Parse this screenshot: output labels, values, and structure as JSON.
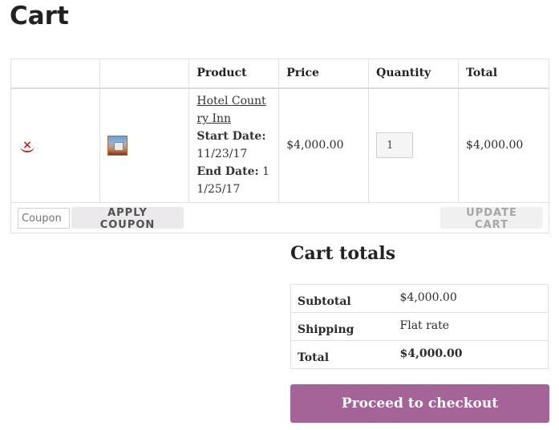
{
  "page": {
    "title": "Cart"
  },
  "cart_table": {
    "headers": [
      "",
      "",
      "Product",
      "Price",
      "Quantity",
      "Total"
    ],
    "item": {
      "remove_symbol": "×",
      "product_name": "Hotel Country Inn",
      "start_label": "Start Date:",
      "start_value": "11/23/17",
      "end_label": "End Date:",
      "end_value": "11/25/17",
      "price": "$4,000.00",
      "quantity": "1",
      "total": "$4,000.00",
      "thumbnail_icon": "hotel-image-icon"
    },
    "coupon_placeholder": "Coupon",
    "apply_coupon_label": "APPLY COUPON",
    "update_cart_label": "UPDATE CART"
  },
  "cart_totals": {
    "title": "Cart totals",
    "rows": [
      {
        "label": "Subtotal",
        "value": "$4,000.00"
      },
      {
        "label": "Shipping",
        "value": "Flat rate"
      },
      {
        "label": "Total",
        "value": "$4,000.00"
      }
    ],
    "checkout_label": "Proceed to checkout"
  },
  "colors": {
    "accent": "#a46497",
    "remove": "#d21b1b"
  }
}
